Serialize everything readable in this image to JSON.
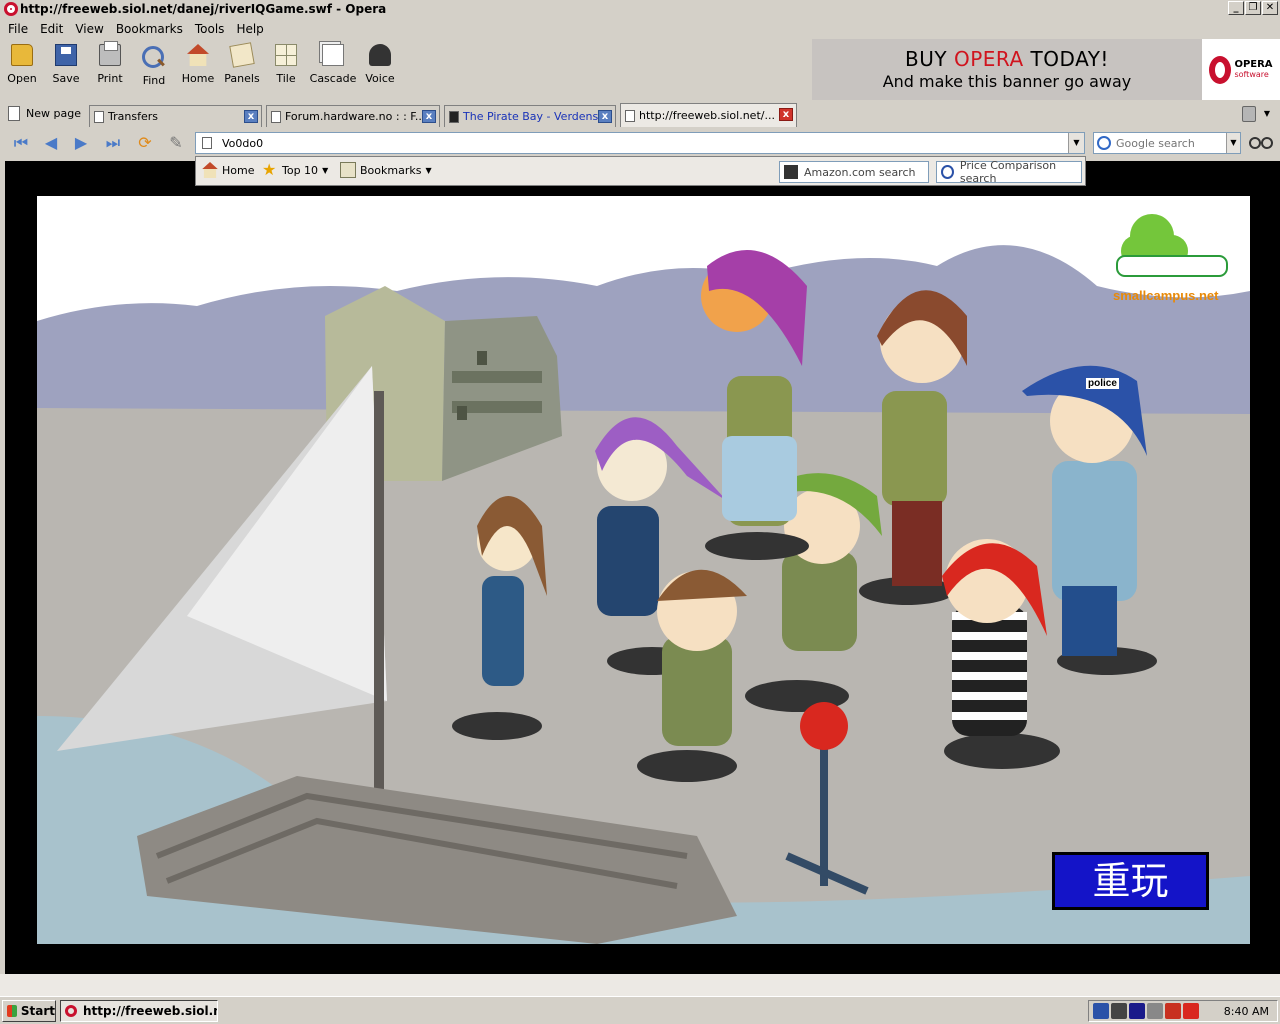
{
  "window": {
    "title": "http://freeweb.siol.net/danej/riverIQGame.swf - Opera"
  },
  "menu": [
    "File",
    "Edit",
    "View",
    "Bookmarks",
    "Tools",
    "Help"
  ],
  "toolbar": {
    "open": "Open",
    "save": "Save",
    "print": "Print",
    "find": "Find",
    "home": "Home",
    "panels": "Panels",
    "tile": "Tile",
    "cascade": "Cascade",
    "voice": "Voice"
  },
  "banner": {
    "line1_a": "BUY ",
    "line1_b": "OPERA",
    "line1_c": " TODAY!",
    "line2": "And make this banner go away"
  },
  "logo": {
    "name": "OPERA",
    "sub": "software"
  },
  "tabs": {
    "newpage": "New page",
    "items": [
      {
        "label": "Transfers"
      },
      {
        "label": "Forum.hardware.no : : F..."
      },
      {
        "label": "The Pirate Bay - Verdens..."
      },
      {
        "label": "http://freeweb.siol.net/..."
      }
    ]
  },
  "address": {
    "value": "Vo0do0"
  },
  "search": {
    "placeholder": "Google search"
  },
  "personalbar": {
    "home": "Home",
    "top10": "Top 10",
    "bookmarks": "Bookmarks",
    "amazon": "Amazon.com search",
    "price": "Price Comparison search"
  },
  "game": {
    "site": "smallcampus.net",
    "police": "police",
    "replay": "重玩"
  },
  "taskbar": {
    "start": "Start",
    "task": "http://freeweb.siol.n...",
    "clock": "8:40 AM"
  },
  "colors": {
    "accent": "#c8102e",
    "replay_bg": "#1414c8",
    "site_text": "#e88a0a"
  }
}
